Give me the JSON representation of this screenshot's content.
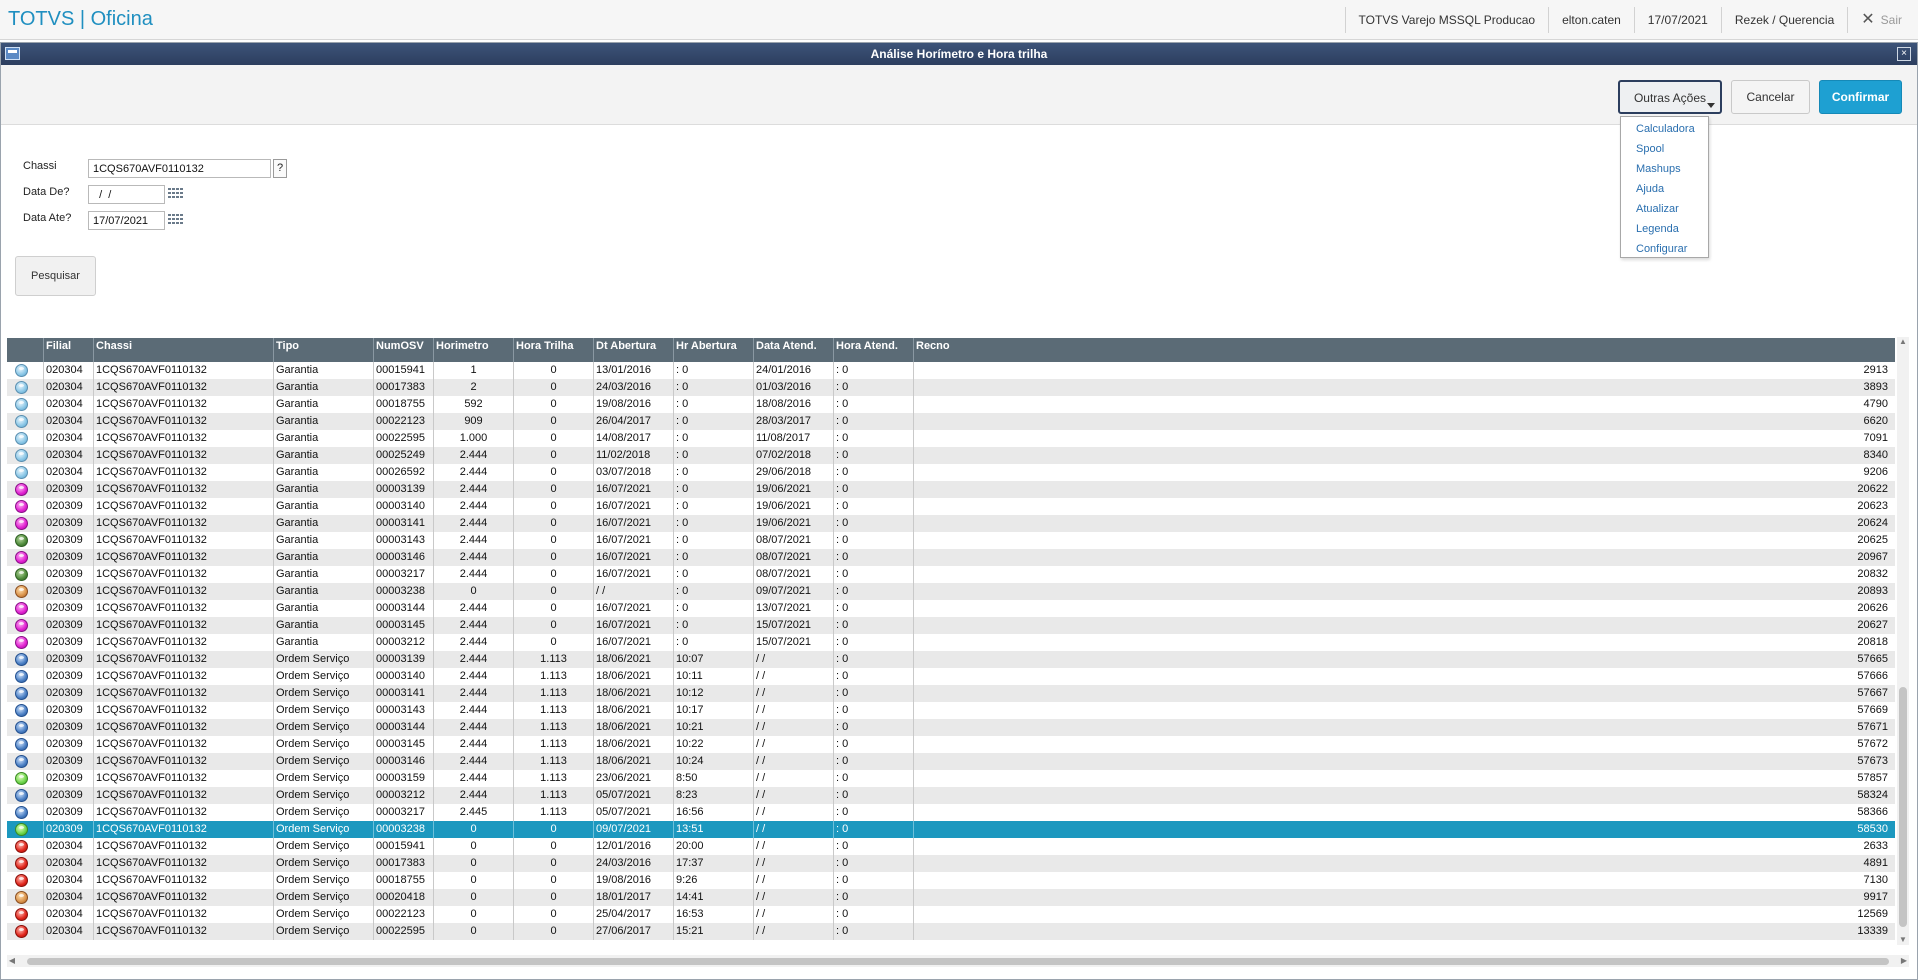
{
  "app": {
    "title": "TOTVS | Oficina"
  },
  "topbar": {
    "environment": "TOTVS Varejo MSSQL Producao",
    "user": "elton.caten",
    "date": "17/07/2021",
    "company": "Rezek / Querencia",
    "exit_label": "Sair"
  },
  "window": {
    "title": "Análise Horímetro e Hora trilha",
    "close_glyph": "×"
  },
  "actions": {
    "outras_acoes": "Outras Ações",
    "cancelar": "Cancelar",
    "confirmar": "Confirmar",
    "menu": [
      "Calculadora",
      "Spool",
      "Mashups",
      "Ajuda",
      "Atualizar",
      "Legenda",
      "Configurar"
    ]
  },
  "form": {
    "chassi": {
      "label": "Chassi",
      "value": "1CQS670AVF0110132",
      "lookup": "?"
    },
    "data_de": {
      "label": "Data De?",
      "value": "  /  /"
    },
    "data_ate": {
      "label": "Data Ate?",
      "value": "17/07/2021"
    },
    "pesquisar": "Pesquisar"
  },
  "grid": {
    "columns": [
      "Filial",
      "Chassi",
      "Tipo",
      "NumOSV",
      "Horimetro",
      "Hora Trilha",
      "Dt Abertura",
      "Hr Abertura",
      "Data Atend.",
      "Hora Atend.",
      "Recno"
    ],
    "selected_index": 27,
    "rows": [
      {
        "status": "light",
        "filial": "020304",
        "chassi": "1CQS670AVF0110132",
        "tipo": "Garantia",
        "numosv": "00015941",
        "horimetro": "1",
        "hora_trilha": "0",
        "dt_abertura": "13/01/2016",
        "hr_abertura": ": 0",
        "data_atend": "24/01/2016",
        "hora_atend": ": 0",
        "recno": "2913"
      },
      {
        "status": "light",
        "filial": "020304",
        "chassi": "1CQS670AVF0110132",
        "tipo": "Garantia",
        "numosv": "00017383",
        "horimetro": "2",
        "hora_trilha": "0",
        "dt_abertura": "24/03/2016",
        "hr_abertura": ": 0",
        "data_atend": "01/03/2016",
        "hora_atend": ": 0",
        "recno": "3893"
      },
      {
        "status": "light",
        "filial": "020304",
        "chassi": "1CQS670AVF0110132",
        "tipo": "Garantia",
        "numosv": "00018755",
        "horimetro": "592",
        "hora_trilha": "0",
        "dt_abertura": "19/08/2016",
        "hr_abertura": ": 0",
        "data_atend": "18/08/2016",
        "hora_atend": ": 0",
        "recno": "4790"
      },
      {
        "status": "light",
        "filial": "020304",
        "chassi": "1CQS670AVF0110132",
        "tipo": "Garantia",
        "numosv": "00022123",
        "horimetro": "909",
        "hora_trilha": "0",
        "dt_abertura": "26/04/2017",
        "hr_abertura": ": 0",
        "data_atend": "28/03/2017",
        "hora_atend": ": 0",
        "recno": "6620"
      },
      {
        "status": "light",
        "filial": "020304",
        "chassi": "1CQS670AVF0110132",
        "tipo": "Garantia",
        "numosv": "00022595",
        "horimetro": "1.000",
        "hora_trilha": "0",
        "dt_abertura": "14/08/2017",
        "hr_abertura": ": 0",
        "data_atend": "11/08/2017",
        "hora_atend": ": 0",
        "recno": "7091"
      },
      {
        "status": "light",
        "filial": "020304",
        "chassi": "1CQS670AVF0110132",
        "tipo": "Garantia",
        "numosv": "00025249",
        "horimetro": "2.444",
        "hora_trilha": "0",
        "dt_abertura": "11/02/2018",
        "hr_abertura": ": 0",
        "data_atend": "07/02/2018",
        "hora_atend": ": 0",
        "recno": "8340"
      },
      {
        "status": "light",
        "filial": "020304",
        "chassi": "1CQS670AVF0110132",
        "tipo": "Garantia",
        "numosv": "00026592",
        "horimetro": "2.444",
        "hora_trilha": "0",
        "dt_abertura": "03/07/2018",
        "hr_abertura": ": 0",
        "data_atend": "29/06/2018",
        "hora_atend": ": 0",
        "recno": "9206"
      },
      {
        "status": "magenta",
        "filial": "020309",
        "chassi": "1CQS670AVF0110132",
        "tipo": "Garantia",
        "numosv": "00003139",
        "horimetro": "2.444",
        "hora_trilha": "0",
        "dt_abertura": "16/07/2021",
        "hr_abertura": ": 0",
        "data_atend": "19/06/2021",
        "hora_atend": ": 0",
        "recno": "20622"
      },
      {
        "status": "magenta",
        "filial": "020309",
        "chassi": "1CQS670AVF0110132",
        "tipo": "Garantia",
        "numosv": "00003140",
        "horimetro": "2.444",
        "hora_trilha": "0",
        "dt_abertura": "16/07/2021",
        "hr_abertura": ": 0",
        "data_atend": "19/06/2021",
        "hora_atend": ": 0",
        "recno": "20623"
      },
      {
        "status": "magenta",
        "filial": "020309",
        "chassi": "1CQS670AVF0110132",
        "tipo": "Garantia",
        "numosv": "00003141",
        "horimetro": "2.444",
        "hora_trilha": "0",
        "dt_abertura": "16/07/2021",
        "hr_abertura": ": 0",
        "data_atend": "19/06/2021",
        "hora_atend": ": 0",
        "recno": "20624"
      },
      {
        "status": "dgreen",
        "filial": "020309",
        "chassi": "1CQS670AVF0110132",
        "tipo": "Garantia",
        "numosv": "00003143",
        "horimetro": "2.444",
        "hora_trilha": "0",
        "dt_abertura": "16/07/2021",
        "hr_abertura": ": 0",
        "data_atend": "08/07/2021",
        "hora_atend": ": 0",
        "recno": "20625"
      },
      {
        "status": "magenta",
        "filial": "020309",
        "chassi": "1CQS670AVF0110132",
        "tipo": "Garantia",
        "numosv": "00003146",
        "horimetro": "2.444",
        "hora_trilha": "0",
        "dt_abertura": "16/07/2021",
        "hr_abertura": ": 0",
        "data_atend": "08/07/2021",
        "hora_atend": ": 0",
        "recno": "20967"
      },
      {
        "status": "dgreen",
        "filial": "020309",
        "chassi": "1CQS670AVF0110132",
        "tipo": "Garantia",
        "numosv": "00003217",
        "horimetro": "2.444",
        "hora_trilha": "0",
        "dt_abertura": "16/07/2021",
        "hr_abertura": ": 0",
        "data_atend": "08/07/2021",
        "hora_atend": ": 0",
        "recno": "20832"
      },
      {
        "status": "brown",
        "filial": "020309",
        "chassi": "1CQS670AVF0110132",
        "tipo": "Garantia",
        "numosv": "00003238",
        "horimetro": "0",
        "hora_trilha": "0",
        "dt_abertura": " /  /",
        "hr_abertura": ": 0",
        "data_atend": "09/07/2021",
        "hora_atend": ": 0",
        "recno": "20893"
      },
      {
        "status": "magenta",
        "filial": "020309",
        "chassi": "1CQS670AVF0110132",
        "tipo": "Garantia",
        "numosv": "00003144",
        "horimetro": "2.444",
        "hora_trilha": "0",
        "dt_abertura": "16/07/2021",
        "hr_abertura": ": 0",
        "data_atend": "13/07/2021",
        "hora_atend": ": 0",
        "recno": "20626"
      },
      {
        "status": "magenta",
        "filial": "020309",
        "chassi": "1CQS670AVF0110132",
        "tipo": "Garantia",
        "numosv": "00003145",
        "horimetro": "2.444",
        "hora_trilha": "0",
        "dt_abertura": "16/07/2021",
        "hr_abertura": ": 0",
        "data_atend": "15/07/2021",
        "hora_atend": ": 0",
        "recno": "20627"
      },
      {
        "status": "magenta",
        "filial": "020309",
        "chassi": "1CQS670AVF0110132",
        "tipo": "Garantia",
        "numosv": "00003212",
        "horimetro": "2.444",
        "hora_trilha": "0",
        "dt_abertura": "16/07/2021",
        "hr_abertura": ": 0",
        "data_atend": "15/07/2021",
        "hora_atend": ": 0",
        "recno": "20818"
      },
      {
        "status": "blue",
        "filial": "020309",
        "chassi": "1CQS670AVF0110132",
        "tipo": "Ordem Serviço",
        "numosv": "00003139",
        "horimetro": "2.444",
        "hora_trilha": "1.113",
        "dt_abertura": "18/06/2021",
        "hr_abertura": "10:07",
        "data_atend": " /  /",
        "hora_atend": ": 0",
        "recno": "57665"
      },
      {
        "status": "blue",
        "filial": "020309",
        "chassi": "1CQS670AVF0110132",
        "tipo": "Ordem Serviço",
        "numosv": "00003140",
        "horimetro": "2.444",
        "hora_trilha": "1.113",
        "dt_abertura": "18/06/2021",
        "hr_abertura": "10:11",
        "data_atend": " /  /",
        "hora_atend": ": 0",
        "recno": "57666"
      },
      {
        "status": "blue",
        "filial": "020309",
        "chassi": "1CQS670AVF0110132",
        "tipo": "Ordem Serviço",
        "numosv": "00003141",
        "horimetro": "2.444",
        "hora_trilha": "1.113",
        "dt_abertura": "18/06/2021",
        "hr_abertura": "10:12",
        "data_atend": " /  /",
        "hora_atend": ": 0",
        "recno": "57667"
      },
      {
        "status": "blue",
        "filial": "020309",
        "chassi": "1CQS670AVF0110132",
        "tipo": "Ordem Serviço",
        "numosv": "00003143",
        "horimetro": "2.444",
        "hora_trilha": "1.113",
        "dt_abertura": "18/06/2021",
        "hr_abertura": "10:17",
        "data_atend": " /  /",
        "hora_atend": ": 0",
        "recno": "57669"
      },
      {
        "status": "blue",
        "filial": "020309",
        "chassi": "1CQS670AVF0110132",
        "tipo": "Ordem Serviço",
        "numosv": "00003144",
        "horimetro": "2.444",
        "hora_trilha": "1.113",
        "dt_abertura": "18/06/2021",
        "hr_abertura": "10:21",
        "data_atend": " /  /",
        "hora_atend": ": 0",
        "recno": "57671"
      },
      {
        "status": "blue",
        "filial": "020309",
        "chassi": "1CQS670AVF0110132",
        "tipo": "Ordem Serviço",
        "numosv": "00003145",
        "horimetro": "2.444",
        "hora_trilha": "1.113",
        "dt_abertura": "18/06/2021",
        "hr_abertura": "10:22",
        "data_atend": " /  /",
        "hora_atend": ": 0",
        "recno": "57672"
      },
      {
        "status": "blue",
        "filial": "020309",
        "chassi": "1CQS670AVF0110132",
        "tipo": "Ordem Serviço",
        "numosv": "00003146",
        "horimetro": "2.444",
        "hora_trilha": "1.113",
        "dt_abertura": "18/06/2021",
        "hr_abertura": "10:24",
        "data_atend": " /  /",
        "hora_atend": ": 0",
        "recno": "57673"
      },
      {
        "status": "green",
        "filial": "020309",
        "chassi": "1CQS670AVF0110132",
        "tipo": "Ordem Serviço",
        "numosv": "00003159",
        "horimetro": "2.444",
        "hora_trilha": "1.113",
        "dt_abertura": "23/06/2021",
        "hr_abertura": "8:50",
        "data_atend": " /  /",
        "hora_atend": ": 0",
        "recno": "57857"
      },
      {
        "status": "blue",
        "filial": "020309",
        "chassi": "1CQS670AVF0110132",
        "tipo": "Ordem Serviço",
        "numosv": "00003212",
        "horimetro": "2.444",
        "hora_trilha": "1.113",
        "dt_abertura": "05/07/2021",
        "hr_abertura": "8:23",
        "data_atend": " /  /",
        "hora_atend": ": 0",
        "recno": "58324"
      },
      {
        "status": "blue",
        "filial": "020309",
        "chassi": "1CQS670AVF0110132",
        "tipo": "Ordem Serviço",
        "numosv": "00003217",
        "horimetro": "2.445",
        "hora_trilha": "1.113",
        "dt_abertura": "05/07/2021",
        "hr_abertura": "16:56",
        "data_atend": " /  /",
        "hora_atend": ": 0",
        "recno": "58366"
      },
      {
        "status": "green",
        "filial": "020309",
        "chassi": "1CQS670AVF0110132",
        "tipo": "Ordem Serviço",
        "numosv": "00003238",
        "horimetro": "0",
        "hora_trilha": "0",
        "dt_abertura": "09/07/2021",
        "hr_abertura": "13:51",
        "data_atend": " /  /",
        "hora_atend": ": 0",
        "recno": "58530"
      },
      {
        "status": "red",
        "filial": "020304",
        "chassi": "1CQS670AVF0110132",
        "tipo": "Ordem Serviço",
        "numosv": "00015941",
        "horimetro": "0",
        "hora_trilha": "0",
        "dt_abertura": "12/01/2016",
        "hr_abertura": "20:00",
        "data_atend": " /  /",
        "hora_atend": ": 0",
        "recno": "2633"
      },
      {
        "status": "red",
        "filial": "020304",
        "chassi": "1CQS670AVF0110132",
        "tipo": "Ordem Serviço",
        "numosv": "00017383",
        "horimetro": "0",
        "hora_trilha": "0",
        "dt_abertura": "24/03/2016",
        "hr_abertura": "17:37",
        "data_atend": " /  /",
        "hora_atend": ": 0",
        "recno": "4891"
      },
      {
        "status": "red",
        "filial": "020304",
        "chassi": "1CQS670AVF0110132",
        "tipo": "Ordem Serviço",
        "numosv": "00018755",
        "horimetro": "0",
        "hora_trilha": "0",
        "dt_abertura": "19/08/2016",
        "hr_abertura": "9:26",
        "data_atend": " /  /",
        "hora_atend": ": 0",
        "recno": "7130"
      },
      {
        "status": "brown",
        "filial": "020304",
        "chassi": "1CQS670AVF0110132",
        "tipo": "Ordem Serviço",
        "numosv": "00020418",
        "horimetro": "0",
        "hora_trilha": "0",
        "dt_abertura": "18/01/2017",
        "hr_abertura": "14:41",
        "data_atend": " /  /",
        "hora_atend": ": 0",
        "recno": "9917"
      },
      {
        "status": "red",
        "filial": "020304",
        "chassi": "1CQS670AVF0110132",
        "tipo": "Ordem Serviço",
        "numosv": "00022123",
        "horimetro": "0",
        "hora_trilha": "0",
        "dt_abertura": "25/04/2017",
        "hr_abertura": "16:53",
        "data_atend": " /  /",
        "hora_atend": ": 0",
        "recno": "12569"
      },
      {
        "status": "red",
        "filial": "020304",
        "chassi": "1CQS670AVF0110132",
        "tipo": "Ordem Serviço",
        "numosv": "00022595",
        "horimetro": "0",
        "hora_trilha": "0",
        "dt_abertura": "27/06/2017",
        "hr_abertura": "15:21",
        "data_atend": " /  /",
        "hora_atend": ": 0",
        "recno": "13339"
      }
    ]
  },
  "colors": {
    "brand": "#1f8fc0",
    "confirm": "#1ea0d2",
    "header": "#5b6b76",
    "selected_row": "#1c98bf",
    "titlebar": "#2c3e5e"
  }
}
